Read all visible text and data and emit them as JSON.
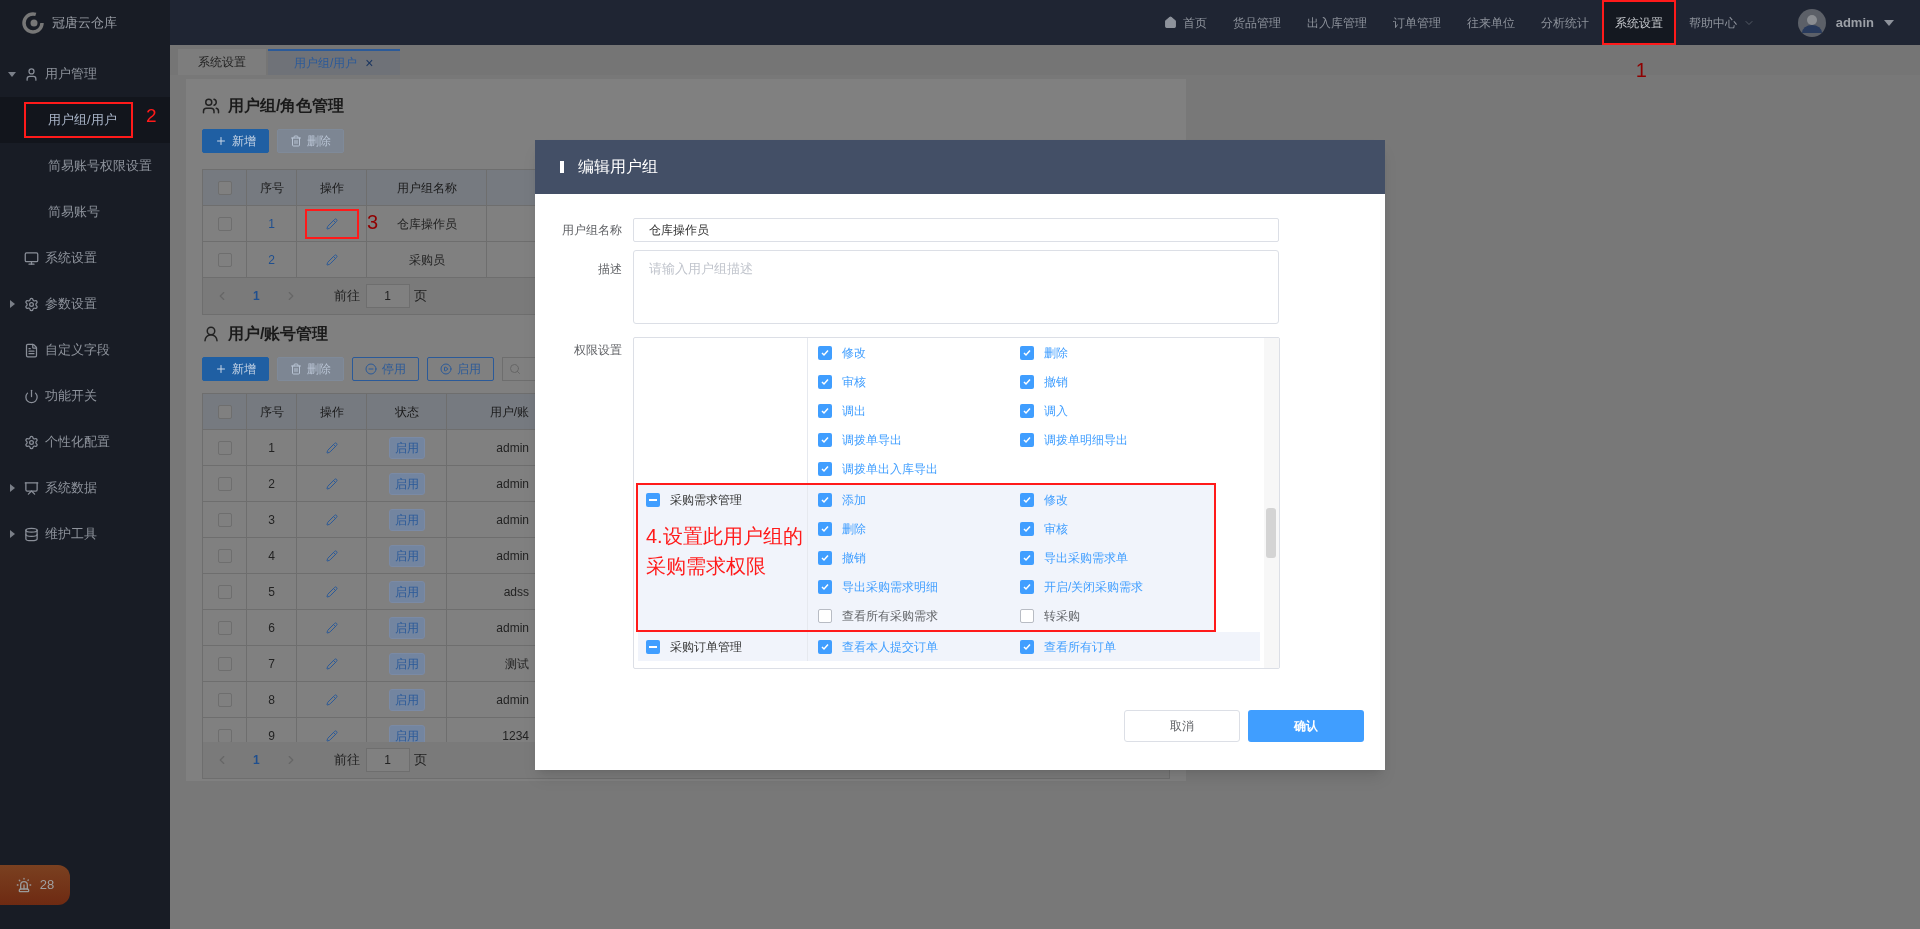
{
  "app": {
    "name": "冠唐云仓库"
  },
  "nav": [
    {
      "label": "首页",
      "kind": "home",
      "selected": false
    },
    {
      "label": "货品管理",
      "kind": "plain",
      "selected": false
    },
    {
      "label": "出入库管理",
      "kind": "plain",
      "selected": false
    },
    {
      "label": "订单管理",
      "kind": "plain",
      "selected": false
    },
    {
      "label": "往来单位",
      "kind": "plain",
      "selected": false
    },
    {
      "label": "分析统计",
      "kind": "plain",
      "selected": false
    },
    {
      "label": "系统设置",
      "kind": "plain",
      "selected": true,
      "annotation": "1"
    },
    {
      "label": "帮助中心",
      "kind": "dropdown",
      "selected": false
    }
  ],
  "user": {
    "name": "admin"
  },
  "sidebar": {
    "items": [
      {
        "label": "用户管理",
        "expanded": true,
        "children": [
          {
            "label": "用户组/用户",
            "selected": true,
            "annotation": "2"
          },
          {
            "label": "简易账号权限设置",
            "selected": false
          },
          {
            "label": "简易账号",
            "selected": false
          }
        ]
      },
      {
        "label": "系统设置"
      },
      {
        "label": "参数设置",
        "expanded": false
      },
      {
        "label": "自定义字段"
      },
      {
        "label": "功能开关"
      },
      {
        "label": "个性化配置"
      },
      {
        "label": "系统数据",
        "expanded": false
      },
      {
        "label": "维护工具",
        "expanded": false
      }
    ],
    "alarm_badge": "28"
  },
  "tabs": [
    {
      "label": "系统设置",
      "selected": false
    },
    {
      "label": "用户组/用户",
      "selected": true,
      "close": "×"
    }
  ],
  "group_section": {
    "title": "用户组/角色管理",
    "buttons": [
      {
        "label": "新增",
        "kind": "add"
      },
      {
        "label": "删除",
        "kind": "delete"
      }
    ],
    "columns": [
      "序号",
      "操作",
      "用户组名称"
    ],
    "all_checked": false,
    "rows": [
      {
        "index": "1",
        "name": "仓库操作员",
        "annotation": "3",
        "checked": false
      },
      {
        "index": "2",
        "name": "采购员",
        "checked": false
      }
    ],
    "pagination": {
      "page": "1",
      "goto": "前往",
      "input": "1",
      "unit": "页"
    }
  },
  "user_section": {
    "title": "用户/账号管理",
    "buttons": [
      {
        "label": "新增",
        "kind": "add"
      },
      {
        "label": "删除",
        "kind": "delete"
      },
      {
        "label": "停用",
        "kind": "disable"
      },
      {
        "label": "启用",
        "kind": "enable"
      }
    ],
    "columns": [
      "序号",
      "操作",
      "状态",
      "用户/账"
    ],
    "all_checked": false,
    "rows": [
      {
        "index": "1",
        "status": "启用",
        "account": "admin",
        "checked": false
      },
      {
        "index": "2",
        "status": "启用",
        "account": "admin",
        "checked": false
      },
      {
        "index": "3",
        "status": "启用",
        "account": "admin",
        "checked": false
      },
      {
        "index": "4",
        "status": "启用",
        "account": "admin",
        "checked": false
      },
      {
        "index": "5",
        "status": "启用",
        "account": "adss",
        "checked": false
      },
      {
        "index": "6",
        "status": "启用",
        "account": "admin",
        "checked": false
      },
      {
        "index": "7",
        "status": "启用",
        "account": "测试",
        "checked": false
      },
      {
        "index": "8",
        "status": "启用",
        "account": "admin",
        "checked": false
      },
      {
        "index": "9",
        "status": "启用",
        "account": "1234",
        "checked": false
      }
    ],
    "pagination": {
      "page": "1",
      "goto": "前往",
      "input": "1",
      "unit": "页"
    }
  },
  "dialog": {
    "title": "编辑用户组",
    "name_label": "用户组名称",
    "name_value": "仓库操作员",
    "desc_label": "描述",
    "desc_placeholder": "请输入用户组描述",
    "perm_label": "权限设置",
    "groups": [
      {
        "perms": [
          {
            "label": "修改",
            "checked": true
          },
          {
            "label": "删除",
            "checked": true
          },
          {
            "label": "审核",
            "checked": true
          },
          {
            "label": "撤销",
            "checked": true
          },
          {
            "label": "调出",
            "checked": true
          },
          {
            "label": "调入",
            "checked": true
          },
          {
            "label": "调拨单导出",
            "checked": true
          },
          {
            "label": "调拨单明细导出",
            "checked": true
          },
          {
            "label": "调拨单出入库导出",
            "checked": true
          }
        ]
      },
      {
        "name": "采购需求管理",
        "indeterminate": true,
        "annotation": "4.设置此用户组的采购需求权限",
        "perms": [
          {
            "label": "添加",
            "checked": true
          },
          {
            "label": "修改",
            "checked": true
          },
          {
            "label": "删除",
            "checked": true
          },
          {
            "label": "审核",
            "checked": true
          },
          {
            "label": "撤销",
            "checked": true
          },
          {
            "label": "导出采购需求单",
            "checked": true
          },
          {
            "label": "导出采购需求明细",
            "checked": true
          },
          {
            "label": "开启/关闭采购需求",
            "checked": true
          },
          {
            "label": "查看所有采购需求",
            "checked": false
          },
          {
            "label": "转采购",
            "checked": false
          }
        ]
      },
      {
        "name": "采购订单管理",
        "indeterminate": true,
        "perms": [
          {
            "label": "查看本人提交订单",
            "checked": true
          },
          {
            "label": "查看所有订单",
            "checked": true
          }
        ]
      }
    ],
    "buttons": [
      {
        "label": "取消",
        "kind": "secondary"
      },
      {
        "label": "确认",
        "kind": "primary"
      }
    ]
  }
}
